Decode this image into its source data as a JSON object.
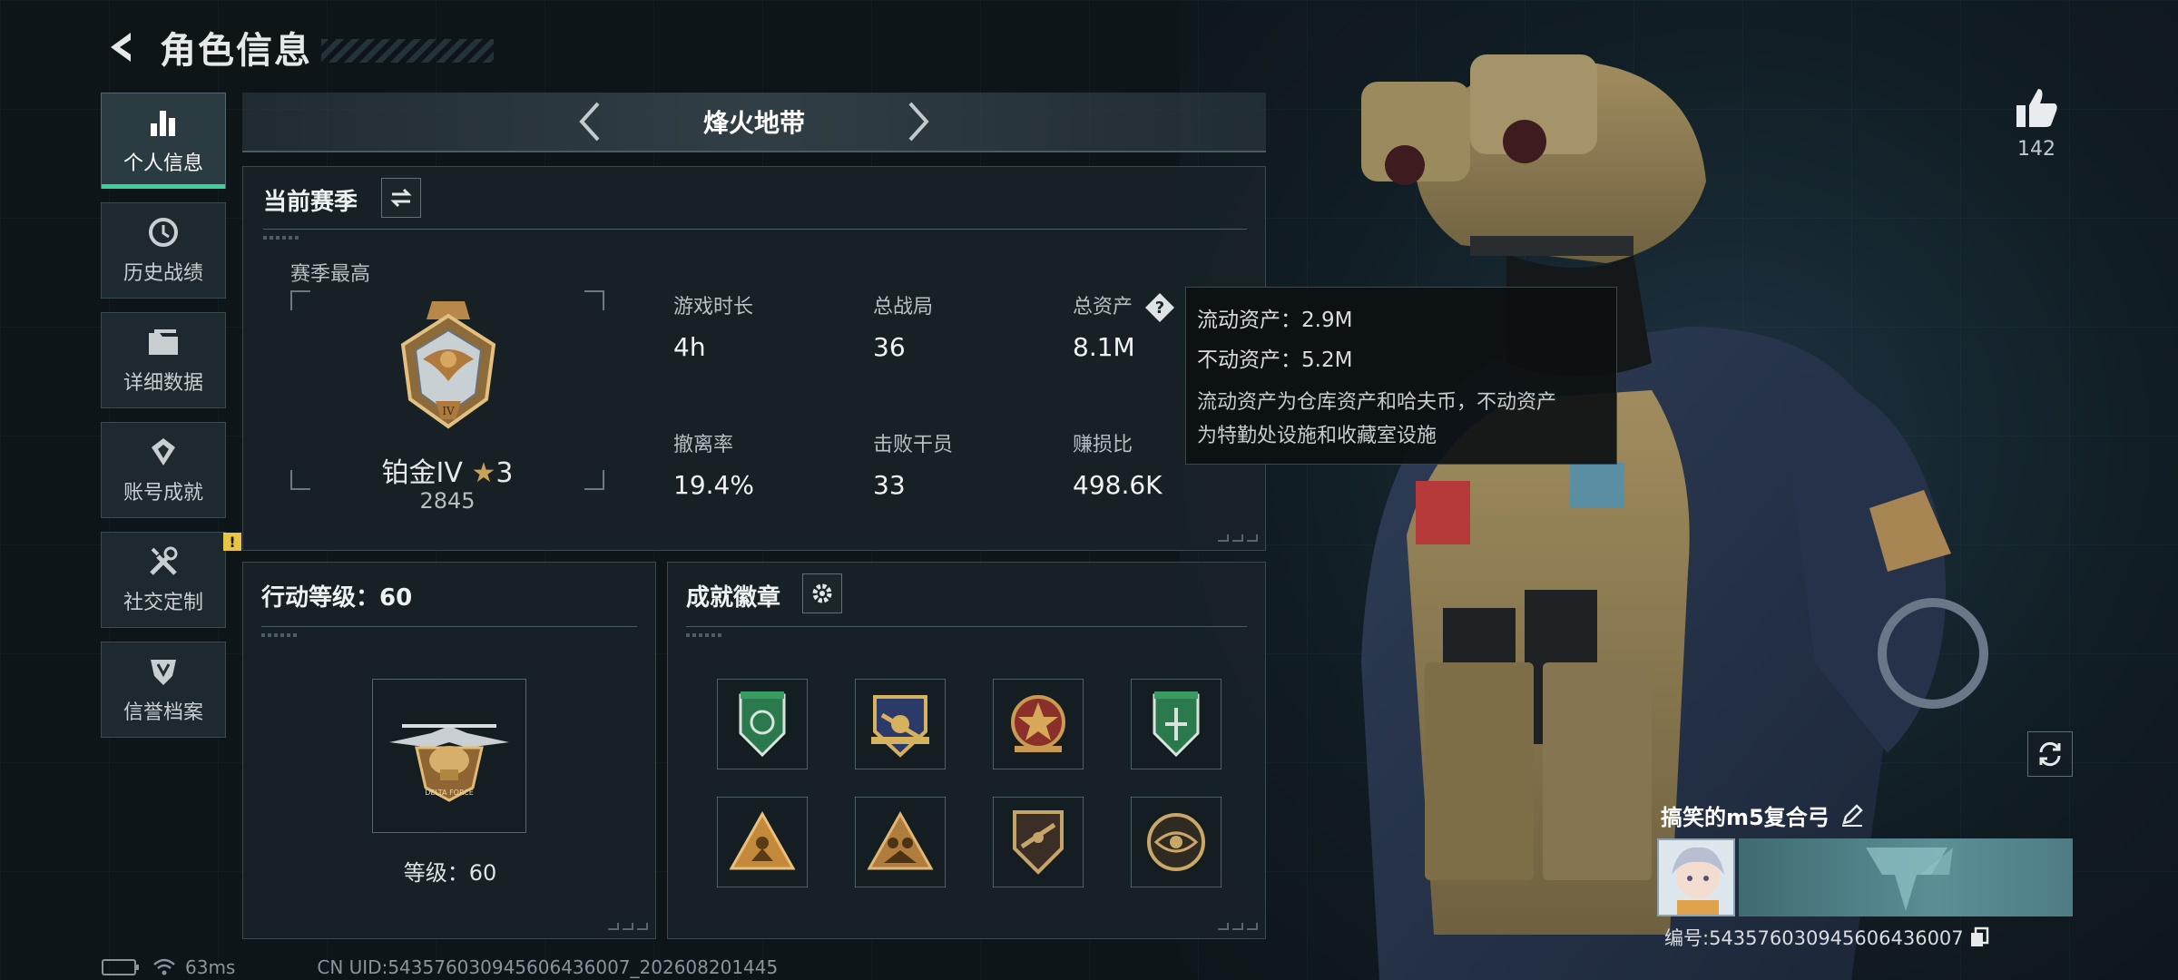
{
  "header": {
    "title": "角色信息"
  },
  "sidebar": {
    "items": [
      {
        "label": "个人信息",
        "icon": "bar-chart-icon",
        "active": true
      },
      {
        "label": "历史战绩",
        "icon": "history-icon"
      },
      {
        "label": "详细数据",
        "icon": "folder-icon"
      },
      {
        "label": "账号成就",
        "icon": "achievement-icon"
      },
      {
        "label": "社交定制",
        "icon": "tools-icon",
        "badge": "!"
      },
      {
        "label": "信誉档案",
        "icon": "shield-icon"
      }
    ]
  },
  "mode_nav": {
    "title": "烽火地带"
  },
  "season": {
    "title": "当前赛季",
    "best_label": "赛季最高",
    "rank_name": "铂金IV",
    "rank_stars": "3",
    "rank_score": "2845",
    "stats": [
      {
        "label": "游戏时长",
        "value": "4h"
      },
      {
        "label": "总战局",
        "value": "36"
      },
      {
        "label": "总资产",
        "value": "8.1M"
      },
      {
        "label": "撤离率",
        "value": "19.4%"
      },
      {
        "label": "击败干员",
        "value": "33"
      },
      {
        "label": "赚损比",
        "value": "498.6K"
      }
    ]
  },
  "tooltip": {
    "liquid": "流动资产：2.9M",
    "fixed": "不动资产：5.2M",
    "desc_line1": "流动资产为仓库资产和哈夫币，不动资产",
    "desc_line2": "为特勤处设施和收藏室设施"
  },
  "level": {
    "title": "行动等级：60",
    "level_text": "等级：60"
  },
  "achievements": {
    "title": "成就徽章"
  },
  "status": {
    "ping": "63ms",
    "uid": "CN UID:543576030945606436007_202608201445"
  },
  "player": {
    "likes": "142",
    "name": "搞笑的m5复合弓",
    "id": "编号:543576030945606436007"
  },
  "colors": {
    "accent": "#3bd39b",
    "warning": "#e9c544",
    "panel": "#18222a"
  }
}
